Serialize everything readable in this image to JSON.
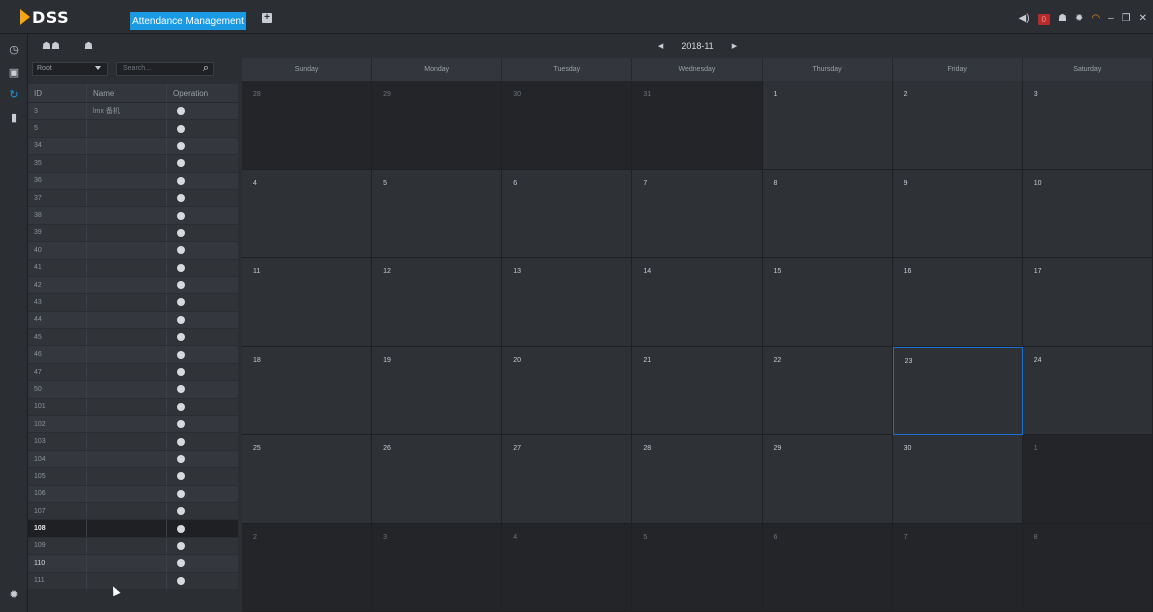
{
  "app": {
    "logo": "DSS",
    "active_tab": "Attendance Management",
    "alarm_count": "0"
  },
  "panel": {
    "select_value": "Root",
    "search_placeholder": "Search...",
    "columns": {
      "id": "ID",
      "name": "Name",
      "operation": "Operation"
    },
    "rows": [
      {
        "id": "3",
        "name": "lmx 备机"
      },
      {
        "id": "5",
        "name": ""
      },
      {
        "id": "34",
        "name": ""
      },
      {
        "id": "35",
        "name": ""
      },
      {
        "id": "36",
        "name": ""
      },
      {
        "id": "37",
        "name": ""
      },
      {
        "id": "38",
        "name": ""
      },
      {
        "id": "39",
        "name": ""
      },
      {
        "id": "40",
        "name": ""
      },
      {
        "id": "41",
        "name": ""
      },
      {
        "id": "42",
        "name": ""
      },
      {
        "id": "43",
        "name": ""
      },
      {
        "id": "44",
        "name": ""
      },
      {
        "id": "45",
        "name": ""
      },
      {
        "id": "46",
        "name": ""
      },
      {
        "id": "47",
        "name": ""
      },
      {
        "id": "50",
        "name": ""
      },
      {
        "id": "101",
        "name": ""
      },
      {
        "id": "102",
        "name": ""
      },
      {
        "id": "103",
        "name": ""
      },
      {
        "id": "104",
        "name": ""
      },
      {
        "id": "105",
        "name": ""
      },
      {
        "id": "106",
        "name": ""
      },
      {
        "id": "107",
        "name": ""
      },
      {
        "id": "108",
        "name": ""
      },
      {
        "id": "109",
        "name": ""
      },
      {
        "id": "110",
        "name": ""
      },
      {
        "id": "111",
        "name": ""
      }
    ],
    "selected_row": "108"
  },
  "calendar": {
    "month": "2018-11",
    "weekdays": [
      "Sunday",
      "Monday",
      "Tuesday",
      "Wednesday",
      "Thursday",
      "Friday",
      "Saturday"
    ],
    "weeks": [
      [
        "28",
        "29",
        "30",
        "31",
        "1",
        "2",
        "3"
      ],
      [
        "4",
        "5",
        "6",
        "7",
        "8",
        "9",
        "10"
      ],
      [
        "11",
        "12",
        "13",
        "14",
        "15",
        "16",
        "17"
      ],
      [
        "18",
        "19",
        "20",
        "21",
        "22",
        "23",
        "24"
      ],
      [
        "25",
        "26",
        "27",
        "28",
        "29",
        "30",
        "1"
      ],
      [
        "2",
        "3",
        "4",
        "5",
        "6",
        "7",
        "8"
      ]
    ],
    "today": "23"
  }
}
